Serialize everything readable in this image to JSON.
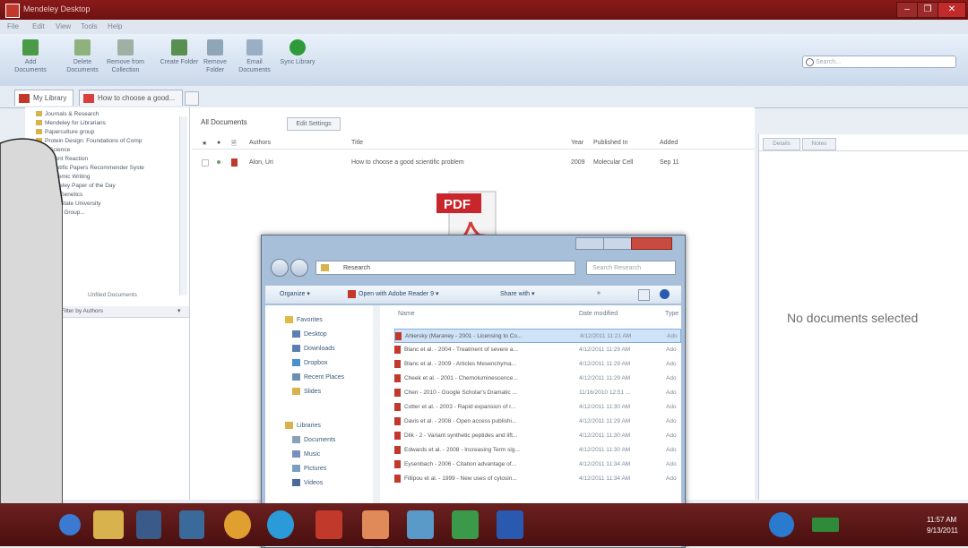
{
  "window": {
    "title": "Mendeley Desktop",
    "min": "–",
    "max": "❐",
    "close": "✕"
  },
  "menu": [
    "File",
    "Edit",
    "View",
    "Tools",
    "Help"
  ],
  "toolbar": {
    "buttons": [
      {
        "label": "Add Documents",
        "icon": "add-documents-icon",
        "color": "#4a9b48"
      },
      {
        "label": "Delete Documents",
        "icon": "delete-documents-icon",
        "color": "#8fb27c"
      },
      {
        "label": "Remove from Collection",
        "icon": "remove-collection-icon",
        "color": "#9fb0a4"
      },
      {
        "label": "Create Folder",
        "icon": "create-folder-icon",
        "color": "#5a8f52"
      },
      {
        "label": "Remove Folder",
        "icon": "remove-folder-icon",
        "color": "#8fa5b8"
      },
      {
        "label": "Email Documents",
        "icon": "email-icon",
        "color": "#9aaec4"
      },
      {
        "label": "Sync Library",
        "icon": "sync-icon",
        "color": "#2f9a3a"
      }
    ],
    "search_placeholder": "Search..."
  },
  "tabs": [
    {
      "label": "My Library"
    },
    {
      "label": "How to choose a good..."
    }
  ],
  "left_tree": [
    "Journals & Research",
    "Mendeley for Librarians",
    "Paperculture group",
    "Protein Design: Foundations of Comp",
    "QScience",
    "Recent Reaction",
    "Scientific Papers Recommender Syste",
    "Academic Writing",
    "Mendeley Paper of the Day",
    "Plant Genetics",
    "Penn State University",
    "Create Group..."
  ],
  "left_lower": {
    "label": "Unfiled Documents",
    "filter": "Filter by Authors"
  },
  "center": {
    "header": "All Documents",
    "edit_settings": "Edit Settings",
    "columns": [
      "★",
      "●",
      "🗎",
      "Authors",
      "Title",
      "Year",
      "Published In",
      "Added"
    ],
    "rows": [
      {
        "authors": "Alon, Uri",
        "title": "How to choose a good scientific problem",
        "year": "2009",
        "published": "Molecular Cell",
        "added": "Sep 11"
      }
    ]
  },
  "right_panel": {
    "tabs": [
      "Details",
      "Notes"
    ],
    "empty_text": "No documents selected"
  },
  "explorer": {
    "address": "Research",
    "search_placeholder": "Search Research",
    "commands": [
      "Organize ▾",
      "Open with Adobe Reader 9 ▾",
      "Share with ▾",
      "»"
    ],
    "col_name": "Name",
    "col_date": "Date modified",
    "col_type": "Type",
    "nav": [
      {
        "label": "Favorites",
        "color": "#e1b84a"
      },
      {
        "label": "Desktop",
        "color": "#5a7fb0"
      },
      {
        "label": "Downloads",
        "color": "#5a7fb0"
      },
      {
        "label": "Dropbox",
        "color": "#4a8fd0"
      },
      {
        "label": "Recent Places",
        "color": "#6a8fb0"
      },
      {
        "label": "Slides",
        "color": "#d8b24c"
      },
      {
        "label": "Libraries",
        "color": "#d8b24c"
      },
      {
        "label": "Documents",
        "color": "#8a9fb8"
      },
      {
        "label": "Music",
        "color": "#7a8fc0"
      },
      {
        "label": "Pictures",
        "color": "#7aa0c0"
      },
      {
        "label": "Videos",
        "color": "#4a6a9a"
      }
    ],
    "files": [
      {
        "name": "Ahlersky (Maraney - 2001 - Licensing to Co...",
        "date": "4/12/2011 11:21 AM",
        "type": "Ado"
      },
      {
        "name": "Blanc et al. - 2004 - Treatment of severe a...",
        "date": "4/12/2011 11:29 AM",
        "type": "Ado"
      },
      {
        "name": "Blanc et al. - 2009 - Articles Mesenchyma...",
        "date": "4/12/2011 11:29 AM",
        "type": "Ado"
      },
      {
        "name": "Cheek et al. - 2001 - Chemoluminescence...",
        "date": "4/12/2011 11:29 AM",
        "type": "Ado"
      },
      {
        "name": "Chen - 2010 - Google Scholar's Dramatic ...",
        "date": "11/16/2010 12:51 ...",
        "type": "Ado"
      },
      {
        "name": "Cotter et al. - 2003 - Rapid expansion of r...",
        "date": "4/12/2011 11:30 AM",
        "type": "Ado"
      },
      {
        "name": "Davis et al. - 2008 - Open access publishi...",
        "date": "4/12/2011 11:29 AM",
        "type": "Ado"
      },
      {
        "name": "Dilk - 2 - Variant synthetic peptides and lift...",
        "date": "4/12/2011 11:30 AM",
        "type": "Ado"
      },
      {
        "name": "Edwards et al. - 2008 - Increasing Term sig...",
        "date": "4/12/2011 11:30 AM",
        "type": "Ado"
      },
      {
        "name": "Eysenbach - 2006 - Citation advantage of...",
        "date": "4/12/2011 11:34 AM",
        "type": "Ado"
      },
      {
        "name": "Fillipou et al. - 1999 - New uses of cytosin...",
        "date": "4/12/2011 11:34 AM",
        "type": "Ado"
      }
    ]
  },
  "taskbar": {
    "icons": [
      {
        "name": "start-button-icon",
        "color": "#3a7ad0"
      },
      {
        "name": "explorer-icon",
        "color": "#d8b24c"
      },
      {
        "name": "media-player-icon",
        "color": "#3a5a8a"
      },
      {
        "name": "app-icon",
        "color": "#3a6a9a"
      },
      {
        "name": "chrome-icon",
        "color": "#e0a030"
      },
      {
        "name": "skype-icon",
        "color": "#2a9ad8"
      },
      {
        "name": "mendeley-icon",
        "color": "#c0392b"
      },
      {
        "name": "paint-icon",
        "color": "#e08a5a"
      },
      {
        "name": "photo-viewer-icon",
        "color": "#5a9ac8"
      },
      {
        "name": "excel-icon",
        "color": "#3a9a4a"
      },
      {
        "name": "word-icon",
        "color": "#2a5ab0"
      }
    ],
    "time": "11:57 AM",
    "date": "9/13/2011"
  }
}
